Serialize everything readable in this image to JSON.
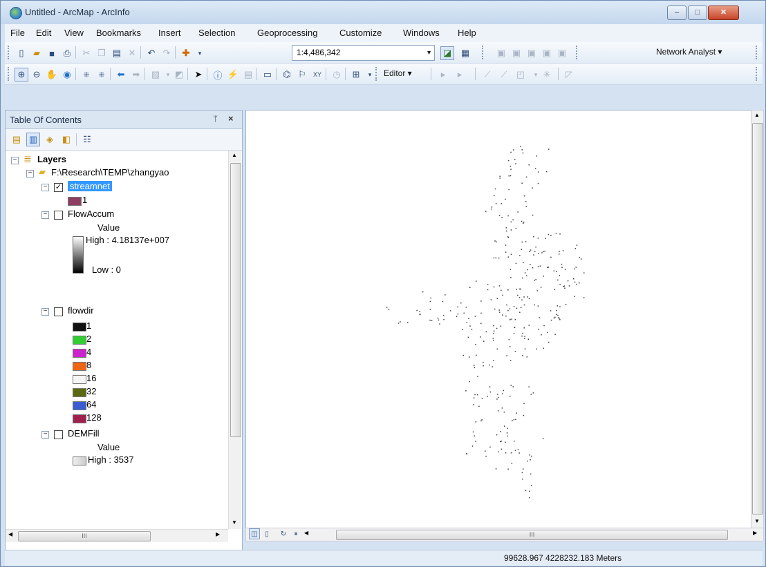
{
  "window": {
    "title": "Untitled - ArcMap - ArcInfo",
    "minimize": "–",
    "maximize": "□",
    "close": "✕"
  },
  "menu": [
    "File",
    "Edit",
    "View",
    "Bookmarks",
    "Insert",
    "Selection",
    "Geoprocessing",
    "Customize",
    "Windows",
    "Help"
  ],
  "toolbar": {
    "scale": "1:4,486,342",
    "network_analyst": "Network Analyst ▾",
    "editor": "Editor ▾"
  },
  "toc": {
    "title": "Table Of Contents",
    "pin": "ᛘ",
    "close": "×",
    "layers_label": "Layers",
    "folder": "F:\\Research\\TEMP\\zhangyao",
    "streamnet": {
      "name": "streamnet",
      "checked": true,
      "class_label": "1",
      "color": "#8e3e62"
    },
    "flowaccum": {
      "name": "FlowAccum",
      "checked": false,
      "value_label": "Value",
      "high": "High : 4.18137e+007",
      "low": "Low : 0"
    },
    "flowdir": {
      "name": "flowdir",
      "checked": false,
      "classes": [
        {
          "label": "1",
          "color": "#111111"
        },
        {
          "label": "2",
          "color": "#33cc33"
        },
        {
          "label": "4",
          "color": "#cc22cc"
        },
        {
          "label": "8",
          "color": "#ee6611"
        },
        {
          "label": "16",
          "color": "#f5f5f5"
        },
        {
          "label": "32",
          "color": "#5b6a12"
        },
        {
          "label": "64",
          "color": "#3b5cd1"
        },
        {
          "label": "128",
          "color": "#a0204d"
        }
      ]
    },
    "demfill": {
      "name": "DEMFill",
      "checked": false,
      "value_label": "Value",
      "high": "High : 3537"
    }
  },
  "map": {
    "scrollbar_grip": "III"
  },
  "status": {
    "coordinates": "99628.967  4228232.183 Meters"
  }
}
